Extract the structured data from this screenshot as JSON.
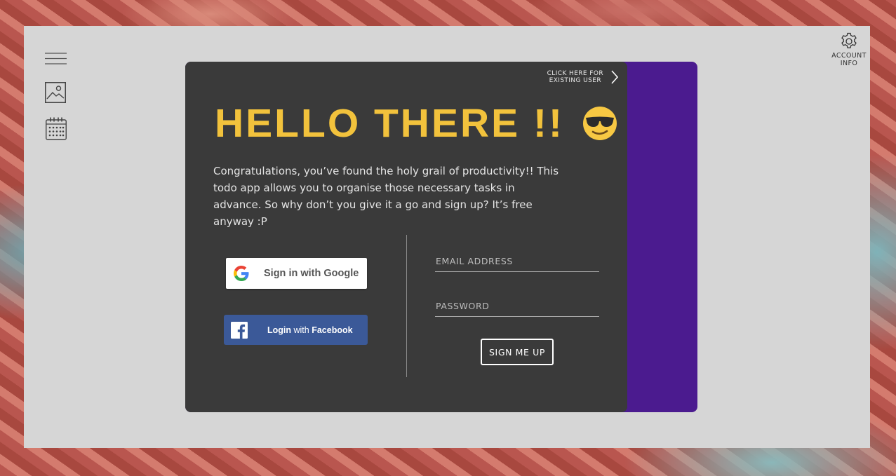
{
  "sidebar": {
    "icons": [
      "menu-icon",
      "image-icon",
      "calendar-icon"
    ]
  },
  "account": {
    "icon": "gear-icon",
    "label": "ACCOUNT\nINFO"
  },
  "card": {
    "existing_user_link": "CLICK HERE FOR\nEXISTING USER",
    "title": "HELLO THERE !!",
    "title_emoji": "sunglasses-emoji-icon",
    "intro": "Congratulations, you’ve found the holy grail of productivity!! This todo app allows you to organise those necessary tasks in advance. So why don’t you give it a go and sign up? It’s free anyway :P",
    "google_button": "Sign in with Google",
    "facebook_button": {
      "login": "Login",
      "with": "with",
      "brand": "Facebook"
    },
    "email": {
      "placeholder": "EMAIL ADDRESS",
      "value": ""
    },
    "password": {
      "placeholder": "PASSWORD",
      "value": ""
    },
    "signup_button": "SIGN ME UP"
  },
  "colors": {
    "panel": "#d6d6d6",
    "card": "#3a3a3a",
    "accent_purple": "#4b1b8f",
    "title_yellow": "#f2c23c",
    "facebook_blue": "#3b5998"
  }
}
